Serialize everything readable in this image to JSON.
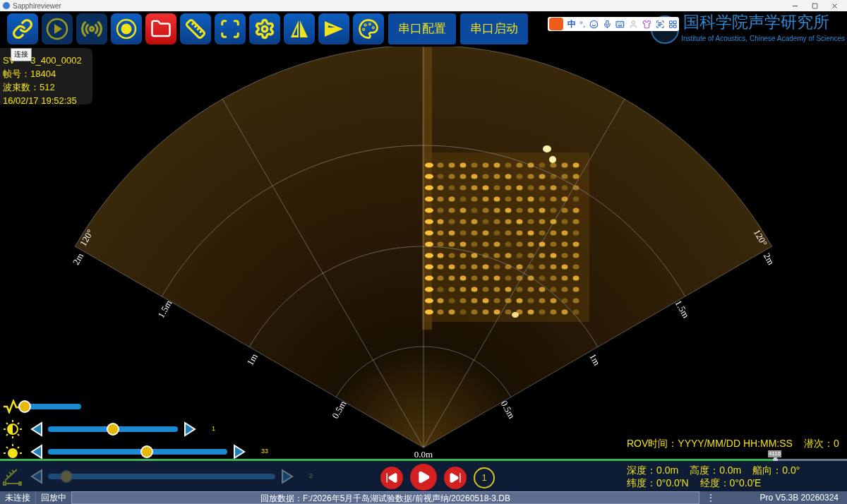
{
  "window": {
    "title": "Sapphireviewer"
  },
  "toolbar": {
    "icon_buttons": [
      {
        "disabled": false,
        "active": false
      },
      {
        "disabled": true,
        "active": false
      },
      {
        "disabled": true,
        "active": false
      },
      {
        "disabled": false,
        "active": false
      },
      {
        "disabled": false,
        "active": true
      },
      {
        "disabled": false,
        "active": false
      },
      {
        "disabled": false,
        "active": false
      },
      {
        "disabled": false,
        "active": false
      },
      {
        "disabled": false,
        "active": false
      },
      {
        "disabled": false,
        "active": false
      },
      {
        "disabled": false,
        "active": false
      }
    ],
    "text_buttons": [
      "串口配置",
      "串口启动"
    ]
  },
  "ime_toolbar": {
    "language": "中",
    "punctuation": "°,"
  },
  "logo": {
    "title": "国科学院声学研究所",
    "subtitle": "Institute of Acoustics, Chinese Academy of Sciences"
  },
  "tooltip": "连接",
  "info": {
    "file_name_start": "SV",
    "file_name_end": "3_400_0002",
    "lines": [
      "帧号：18404",
      "波束数：512",
      "16/02/17 19:52:35"
    ]
  },
  "sonar": {
    "left_range_labels": [
      "0.5m",
      "1m",
      "1.5m",
      "2m"
    ],
    "right_range_labels": [
      "0.5m",
      "1m",
      "1.5m",
      "2m"
    ],
    "left_angle_label": "120°",
    "right_angle_label": "120°",
    "origin_label": "0.0m"
  },
  "sliders": [
    {
      "kind": "plain",
      "level": 0,
      "disabled": false
    },
    {
      "kind": "stepper",
      "level": 0.5,
      "value": "1",
      "disabled": false
    },
    {
      "kind": "stepper",
      "level": 0.55,
      "value": "33",
      "disabled": false
    },
    {
      "kind": "stepper",
      "level": 0.08,
      "value": "2",
      "disabled": true
    }
  ],
  "progress": {
    "level": 0.915,
    "tooltip": "4116"
  },
  "playback": {
    "loop_count": "1"
  },
  "rov": [
    [
      "ROV时间：YYYY/MM/DD HH:MM:SS",
      "潜次：0"
    ],
    [
      "深度：0.0m",
      "高度：0.0m",
      "艏向：0.0°"
    ],
    [
      "纬度：0°0.0′N",
      "经度：0°0.0′E"
    ]
  ],
  "status_bar": {
    "connection": "未连接",
    "mode": "回放中",
    "file": "回放数据：F:/2026年5月千岛湖试验数据/前视声纳/20260518-3.DB",
    "menu": "⋮",
    "version": "Pro V5.3B 20260324"
  }
}
